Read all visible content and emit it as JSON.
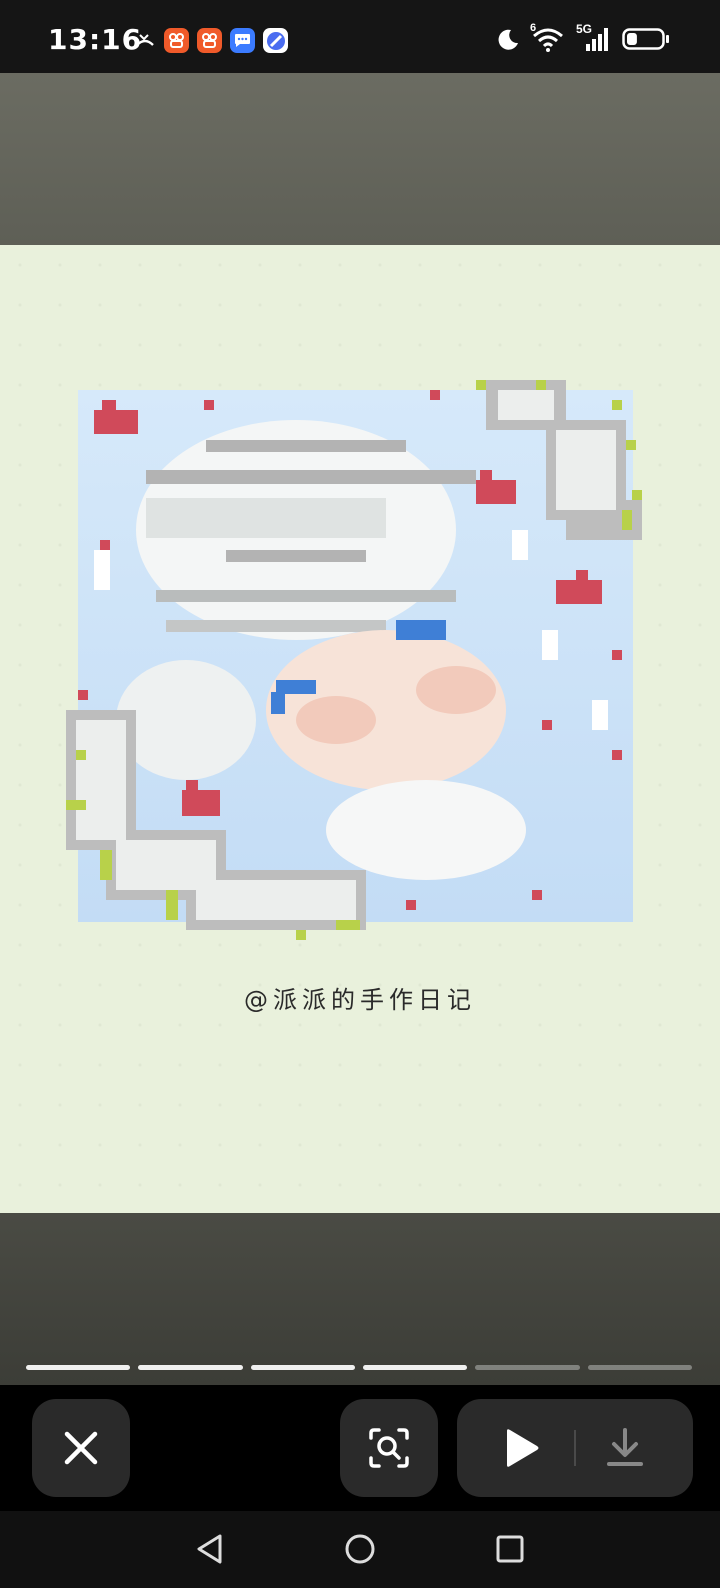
{
  "status_bar": {
    "time": "13:16",
    "network_label": "5G",
    "wifi_badge": "6",
    "battery_level": 0.3
  },
  "story": {
    "caption": "@派派的手作日记",
    "progress": {
      "total_segments": 6,
      "completed_segments": 4
    }
  },
  "controls": {
    "close": "close-icon",
    "lens": "visual-search-icon",
    "play": "play-icon",
    "download": "download-icon"
  },
  "colors": {
    "status_bg": "#151515",
    "image_bg": "#e9f1dc",
    "control_bg": "#2a2a2a",
    "accent_red": "#d04a5a",
    "accent_blue": "#3f7fd6"
  }
}
